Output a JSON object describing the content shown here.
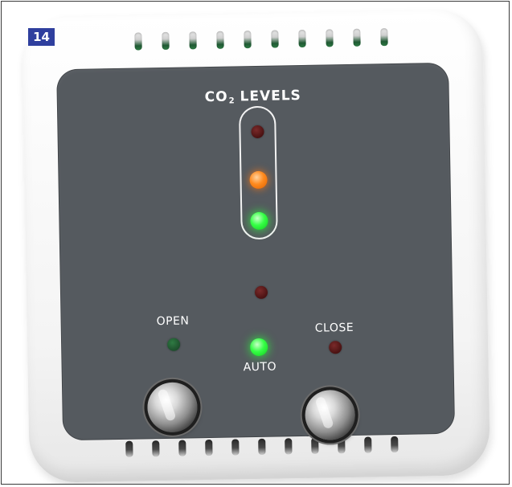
{
  "figure": {
    "number": "14"
  },
  "device": {
    "co2_title_main": "CO",
    "co2_title_subscript": "2",
    "co2_title_suffix": "LEVELS",
    "labels": {
      "open": "OPEN",
      "auto": "AUTO",
      "close": "CLOSE"
    },
    "co2_leds": [
      {
        "name": "high",
        "state": "off",
        "color": "#4a1212"
      },
      {
        "name": "medium",
        "state": "on",
        "color": "#ff8a1e"
      },
      {
        "name": "low",
        "state": "on",
        "color": "#35ff45"
      }
    ],
    "mode_leds": {
      "status": {
        "state": "off",
        "color": "#4a1212"
      },
      "open": {
        "state": "off",
        "color": "#1d4f2c"
      },
      "auto": {
        "state": "on",
        "color": "#35ff45"
      },
      "close": {
        "state": "off",
        "color": "#4a1212"
      }
    }
  },
  "colors": {
    "panel": "#555a5f",
    "housing": "#f4f4f4",
    "badge": "#2f3f9e"
  }
}
